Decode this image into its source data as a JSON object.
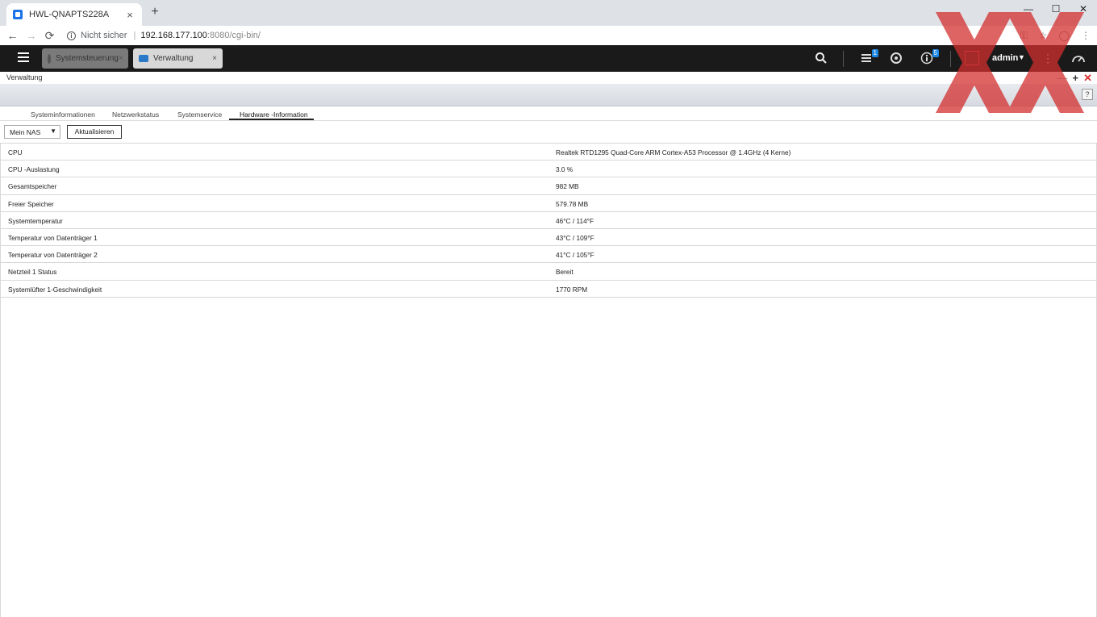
{
  "browser": {
    "tab_title": "HWL-QNAPTS228A",
    "tab_close": "×",
    "new_tab": "+",
    "window_controls": [
      "—",
      "☐",
      "✕"
    ],
    "nav": {
      "back": "←",
      "forward": "→",
      "reload": "⟳"
    },
    "security_text": "Nicht sicher",
    "url_host": "192.168.177.100",
    "url_rest": ":8080/cgi-bin/",
    "toolbar_icons": [
      "key-icon",
      "star-icon",
      "profile-icon",
      "menu-icon"
    ]
  },
  "nas_header": {
    "tabs": [
      {
        "label": "Systemsteuerung",
        "icon": "gear-icon",
        "close": "×"
      },
      {
        "label": "Verwaltung",
        "icon": "monitor-icon",
        "close": "×"
      }
    ],
    "icons": {
      "search": "search-icon",
      "tasks": "tasks-icon",
      "tasks_badge": "1",
      "sync": "sync-icon",
      "info": "info-icon",
      "info_badge": "5",
      "dashboard": "dashboard-icon"
    },
    "user": "admin"
  },
  "window": {
    "title": "Verwaltung",
    "controls": {
      "minimize": "—",
      "maximize": "+",
      "close": "✕"
    },
    "help": "?"
  },
  "subtabs": [
    {
      "label": "Systeminformationen",
      "active": false
    },
    {
      "label": "Netzwerkstatus",
      "active": false
    },
    {
      "label": "Systemservice",
      "active": false
    },
    {
      "label": "Hardware -Information",
      "active": true
    }
  ],
  "controls": {
    "device_select": "Mein NAS",
    "refresh_label": "Aktualisieren"
  },
  "hardware_info": [
    {
      "label": "CPU",
      "value": "Realtek RTD1295 Quad-Core ARM Cortex-A53 Processor @ 1.4GHz (4 Kerne)"
    },
    {
      "label": "CPU -Auslastung",
      "value": "3.0 %"
    },
    {
      "label": "Gesamtspeicher",
      "value": "982 MB"
    },
    {
      "label": "Freier Speicher",
      "value": "579.78 MB"
    },
    {
      "label": "Systemtemperatur",
      "value": "46°C / 114°F"
    },
    {
      "label": "Temperatur von Datenträger 1",
      "value": "43°C / 109°F"
    },
    {
      "label": "Temperatur von Datenträger 2",
      "value": "41°C / 105°F"
    },
    {
      "label": "Netzteil 1 Status",
      "value": "Bereit"
    },
    {
      "label": "Systemlüfter 1-Geschwindigkeit",
      "value": "1770 RPM"
    }
  ],
  "colors": {
    "nas_header_bg": "#1a1a1a",
    "accent_blue": "#1e88e5",
    "watermark_red": "#d32f2f"
  }
}
